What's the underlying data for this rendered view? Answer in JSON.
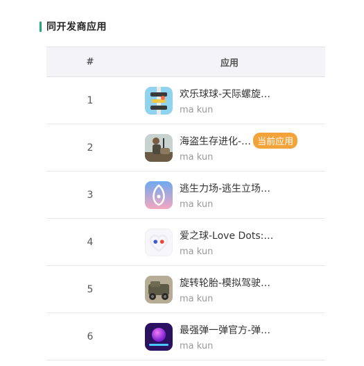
{
  "section": {
    "title": "同开发商应用"
  },
  "table": {
    "headers": {
      "num": "#",
      "app": "应用"
    },
    "rows": [
      {
        "num": "1",
        "name": "欢乐球球-天际螺旋…",
        "developer": "ma kun",
        "icon": "helix-tower-icon"
      },
      {
        "num": "2",
        "name": "海盗生存进化-…",
        "developer": "ma kun",
        "icon": "pirate-survival-icon",
        "badge": "当前应用"
      },
      {
        "num": "3",
        "name": "逃生力场-逃生立场…",
        "developer": "ma kun",
        "icon": "escape-field-icon"
      },
      {
        "num": "4",
        "name": "爱之球-Love Dots:…",
        "developer": "ma kun",
        "icon": "love-dots-icon"
      },
      {
        "num": "5",
        "name": "旋转轮胎-模拟驾驶…",
        "developer": "ma kun",
        "icon": "military-truck-icon"
      },
      {
        "num": "6",
        "name": "最强弹一弹官方-弹…",
        "developer": "ma kun",
        "icon": "bouncing-ball-icon"
      }
    ]
  },
  "colors": {
    "accent": "#1fa67a",
    "badge": "#f2a33a",
    "header_bg": "#f4f4f8"
  }
}
